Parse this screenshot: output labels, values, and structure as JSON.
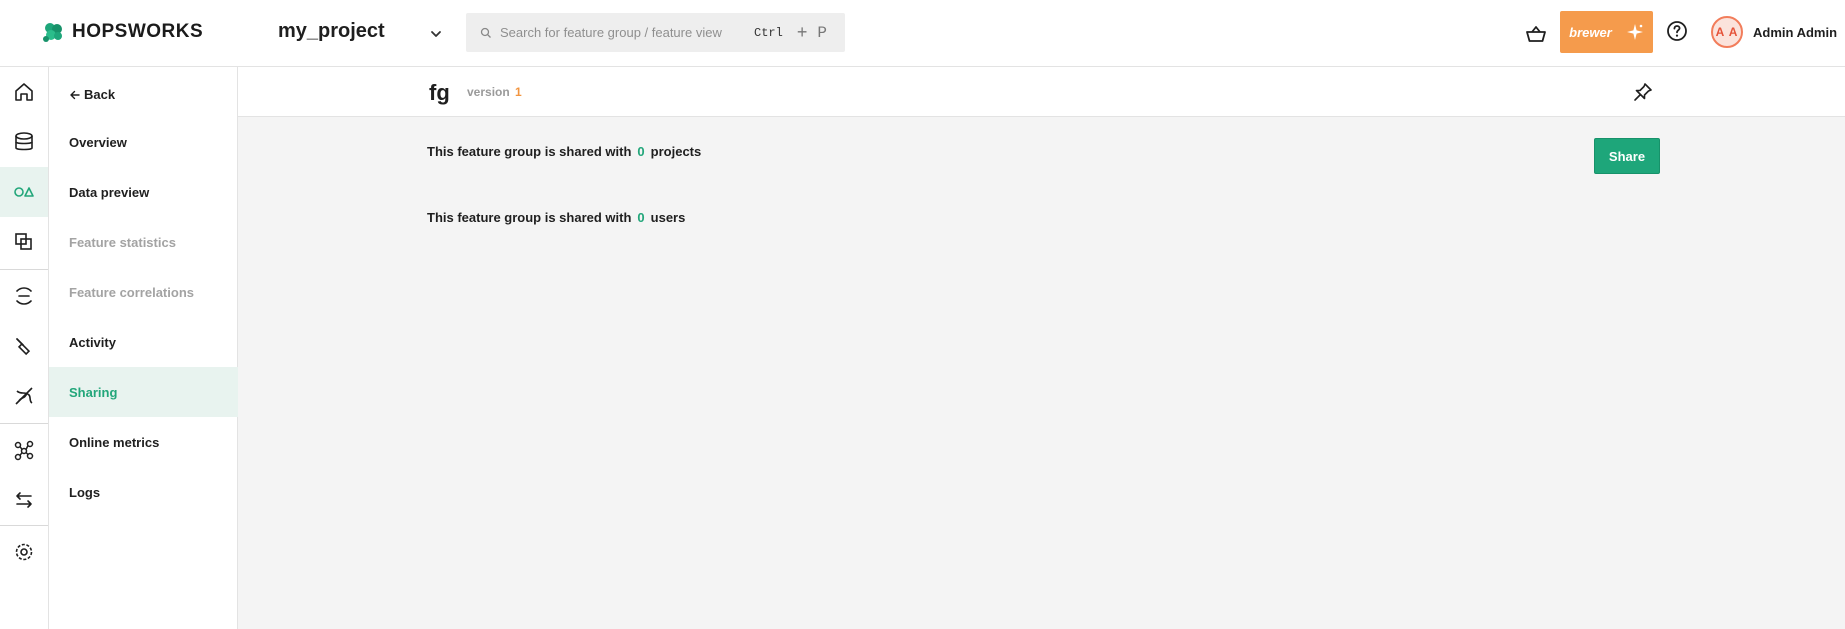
{
  "header": {
    "logo_text": "HOPSWORKS",
    "project_name": "my_project",
    "search_placeholder": "Search for feature group / feature view",
    "shortcut_ctrl": "Ctrl",
    "shortcut_plus": "+",
    "shortcut_key": "P",
    "brewer_label": "brewer",
    "user_initials": "A A",
    "user_name": "Admin Admin"
  },
  "rail": {
    "icons": [
      "home-icon",
      "database-icon",
      "feature-store-icon",
      "feature-views-icon",
      "pipelines-icon",
      "tools-icon",
      "models-icon",
      "graph-icon",
      "transfer-icon",
      "settings-icon"
    ],
    "active_icon": "feature-store-icon"
  },
  "subnav": {
    "back_label": "Back",
    "items": [
      {
        "label": "Overview",
        "state": "normal"
      },
      {
        "label": "Data preview",
        "state": "normal"
      },
      {
        "label": "Feature statistics",
        "state": "disabled"
      },
      {
        "label": "Feature correlations",
        "state": "disabled"
      },
      {
        "label": "Activity",
        "state": "normal"
      },
      {
        "label": "Sharing",
        "state": "active"
      },
      {
        "label": "Online metrics",
        "state": "normal"
      },
      {
        "label": "Logs",
        "state": "normal"
      }
    ]
  },
  "main": {
    "feature_group_name": "fg",
    "version_label": "version",
    "version_number": "1",
    "projects_line": {
      "prefix": "This feature group is shared with",
      "count": "0",
      "suffix": "projects"
    },
    "users_line": {
      "prefix": "This feature group is shared with",
      "count": "0",
      "suffix": "users"
    },
    "share_button_label": "Share"
  },
  "colors": {
    "accent_green": "#22a67a",
    "brewer_orange": "#f59b4c",
    "version_orange": "#f29540",
    "avatar_red": "#e5533a"
  }
}
